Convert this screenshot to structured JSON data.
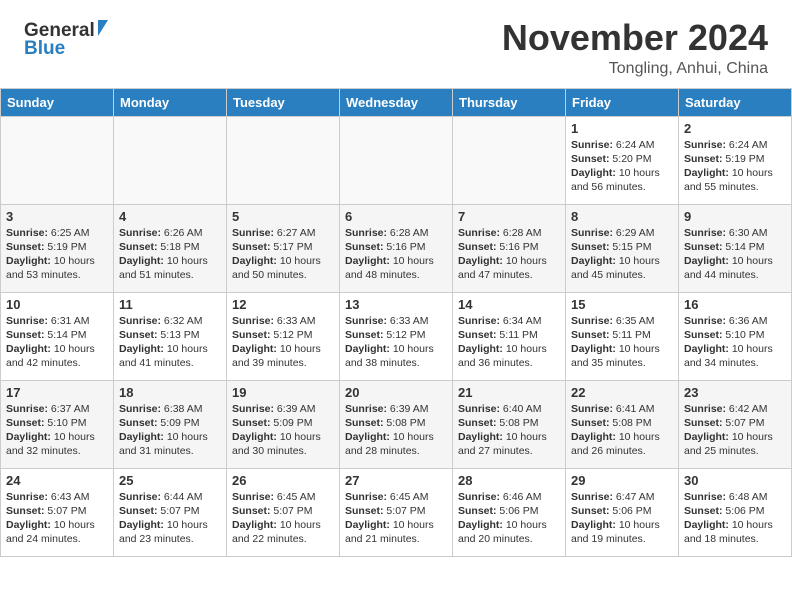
{
  "header": {
    "logo_line1": "General",
    "logo_line2": "Blue",
    "month": "November 2024",
    "location": "Tongling, Anhui, China"
  },
  "days_of_week": [
    "Sunday",
    "Monday",
    "Tuesday",
    "Wednesday",
    "Thursday",
    "Friday",
    "Saturday"
  ],
  "weeks": [
    [
      {
        "day": "",
        "data": ""
      },
      {
        "day": "",
        "data": ""
      },
      {
        "day": "",
        "data": ""
      },
      {
        "day": "",
        "data": ""
      },
      {
        "day": "",
        "data": ""
      },
      {
        "day": "1",
        "data": "Sunrise: 6:24 AM\nSunset: 5:20 PM\nDaylight: 10 hours and 56 minutes."
      },
      {
        "day": "2",
        "data": "Sunrise: 6:24 AM\nSunset: 5:19 PM\nDaylight: 10 hours and 55 minutes."
      }
    ],
    [
      {
        "day": "3",
        "data": "Sunrise: 6:25 AM\nSunset: 5:19 PM\nDaylight: 10 hours and 53 minutes."
      },
      {
        "day": "4",
        "data": "Sunrise: 6:26 AM\nSunset: 5:18 PM\nDaylight: 10 hours and 51 minutes."
      },
      {
        "day": "5",
        "data": "Sunrise: 6:27 AM\nSunset: 5:17 PM\nDaylight: 10 hours and 50 minutes."
      },
      {
        "day": "6",
        "data": "Sunrise: 6:28 AM\nSunset: 5:16 PM\nDaylight: 10 hours and 48 minutes."
      },
      {
        "day": "7",
        "data": "Sunrise: 6:28 AM\nSunset: 5:16 PM\nDaylight: 10 hours and 47 minutes."
      },
      {
        "day": "8",
        "data": "Sunrise: 6:29 AM\nSunset: 5:15 PM\nDaylight: 10 hours and 45 minutes."
      },
      {
        "day": "9",
        "data": "Sunrise: 6:30 AM\nSunset: 5:14 PM\nDaylight: 10 hours and 44 minutes."
      }
    ],
    [
      {
        "day": "10",
        "data": "Sunrise: 6:31 AM\nSunset: 5:14 PM\nDaylight: 10 hours and 42 minutes."
      },
      {
        "day": "11",
        "data": "Sunrise: 6:32 AM\nSunset: 5:13 PM\nDaylight: 10 hours and 41 minutes."
      },
      {
        "day": "12",
        "data": "Sunrise: 6:33 AM\nSunset: 5:12 PM\nDaylight: 10 hours and 39 minutes."
      },
      {
        "day": "13",
        "data": "Sunrise: 6:33 AM\nSunset: 5:12 PM\nDaylight: 10 hours and 38 minutes."
      },
      {
        "day": "14",
        "data": "Sunrise: 6:34 AM\nSunset: 5:11 PM\nDaylight: 10 hours and 36 minutes."
      },
      {
        "day": "15",
        "data": "Sunrise: 6:35 AM\nSunset: 5:11 PM\nDaylight: 10 hours and 35 minutes."
      },
      {
        "day": "16",
        "data": "Sunrise: 6:36 AM\nSunset: 5:10 PM\nDaylight: 10 hours and 34 minutes."
      }
    ],
    [
      {
        "day": "17",
        "data": "Sunrise: 6:37 AM\nSunset: 5:10 PM\nDaylight: 10 hours and 32 minutes."
      },
      {
        "day": "18",
        "data": "Sunrise: 6:38 AM\nSunset: 5:09 PM\nDaylight: 10 hours and 31 minutes."
      },
      {
        "day": "19",
        "data": "Sunrise: 6:39 AM\nSunset: 5:09 PM\nDaylight: 10 hours and 30 minutes."
      },
      {
        "day": "20",
        "data": "Sunrise: 6:39 AM\nSunset: 5:08 PM\nDaylight: 10 hours and 28 minutes."
      },
      {
        "day": "21",
        "data": "Sunrise: 6:40 AM\nSunset: 5:08 PM\nDaylight: 10 hours and 27 minutes."
      },
      {
        "day": "22",
        "data": "Sunrise: 6:41 AM\nSunset: 5:08 PM\nDaylight: 10 hours and 26 minutes."
      },
      {
        "day": "23",
        "data": "Sunrise: 6:42 AM\nSunset: 5:07 PM\nDaylight: 10 hours and 25 minutes."
      }
    ],
    [
      {
        "day": "24",
        "data": "Sunrise: 6:43 AM\nSunset: 5:07 PM\nDaylight: 10 hours and 24 minutes."
      },
      {
        "day": "25",
        "data": "Sunrise: 6:44 AM\nSunset: 5:07 PM\nDaylight: 10 hours and 23 minutes."
      },
      {
        "day": "26",
        "data": "Sunrise: 6:45 AM\nSunset: 5:07 PM\nDaylight: 10 hours and 22 minutes."
      },
      {
        "day": "27",
        "data": "Sunrise: 6:45 AM\nSunset: 5:07 PM\nDaylight: 10 hours and 21 minutes."
      },
      {
        "day": "28",
        "data": "Sunrise: 6:46 AM\nSunset: 5:06 PM\nDaylight: 10 hours and 20 minutes."
      },
      {
        "day": "29",
        "data": "Sunrise: 6:47 AM\nSunset: 5:06 PM\nDaylight: 10 hours and 19 minutes."
      },
      {
        "day": "30",
        "data": "Sunrise: 6:48 AM\nSunset: 5:06 PM\nDaylight: 10 hours and 18 minutes."
      }
    ]
  ]
}
